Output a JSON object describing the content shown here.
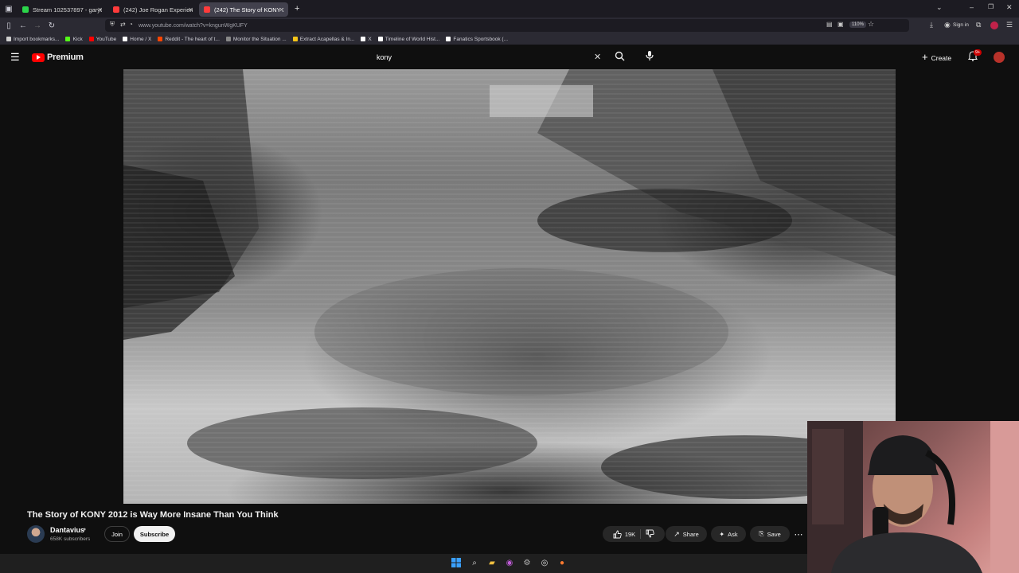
{
  "browser": {
    "tabs": [
      {
        "label": "Stream 102537897 - garydavid",
        "favicon_color": "#2bd44a",
        "active": false
      },
      {
        "label": "(242) Joe Rogan Experience #1",
        "favicon_color": "#ff3b3b",
        "active": false
      },
      {
        "label": "(242) The Story of KONY 2012 i",
        "favicon_color": "#ff3b3b",
        "active": true
      }
    ],
    "new_tab_label": "+",
    "url": "www.youtube.com/watch?v=kngunWgKUFY",
    "zoom": "110%",
    "sign_in_label": "Sign in",
    "bookmarks": [
      {
        "label": "Import bookmarks...",
        "color": "#cfcfcf"
      },
      {
        "label": "Kick",
        "color": "#53fc18"
      },
      {
        "label": "YouTube",
        "color": "#ff0000"
      },
      {
        "label": "Home / X",
        "color": "#ffffff"
      },
      {
        "label": "Reddit - The heart of t...",
        "color": "#ff4500"
      },
      {
        "label": "Monitor the Situation ...",
        "color": "#888888"
      },
      {
        "label": "Extract Acapellas & In...",
        "color": "#f5c518"
      },
      {
        "label": "X",
        "color": "#ffffff"
      },
      {
        "label": "Timeline of World Hist...",
        "color": "#ffffff"
      },
      {
        "label": "Fanatics Sportsbook (...",
        "color": "#ffffff"
      }
    ]
  },
  "youtube": {
    "logo_text": "Premium",
    "search_query": "kony",
    "create_label": "Create",
    "notification_count": "9+",
    "video": {
      "title": "The Story of KONY 2012 is Way More Insane Than You Think",
      "channel": "Dantavius",
      "subscribers": "658K subscribers",
      "join_label": "Join",
      "subscribe_label": "Subscribe",
      "likes": "19K",
      "share_label": "Share",
      "ask_label": "Ask",
      "save_label": "Save"
    }
  },
  "icons": {
    "menu": "☰",
    "search": "⌕",
    "clear": "✕",
    "mic": "🎙",
    "bell": "🔔",
    "like": "👍",
    "dislike": "👎",
    "share": "↗",
    "ask": "✦",
    "save": "⎘",
    "more": "⋯"
  },
  "colors": {
    "accent": "#ff0000",
    "background": "#0f0f0f",
    "pill": "#272727"
  }
}
